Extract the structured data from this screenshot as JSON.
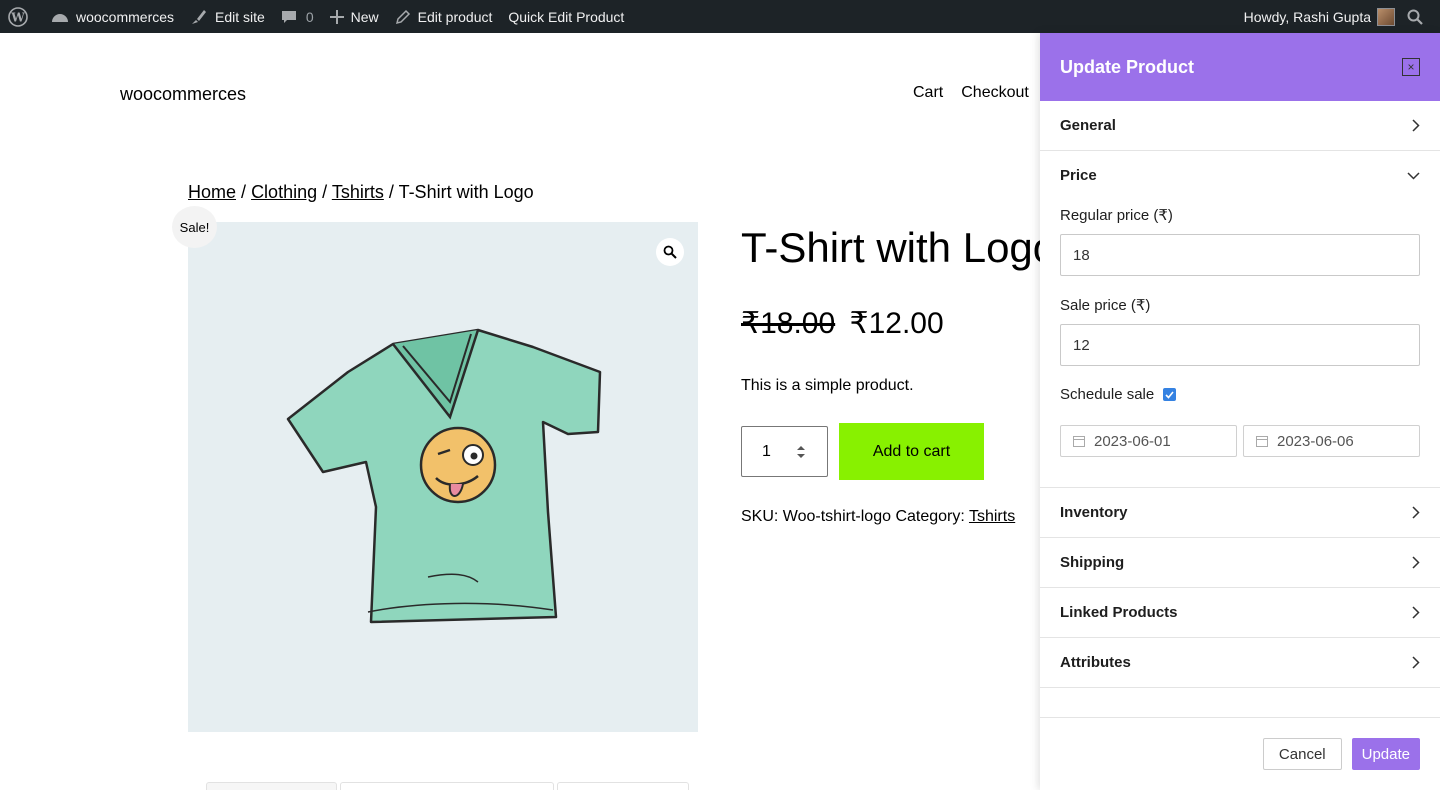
{
  "admin_bar": {
    "site_name": "woocommerces",
    "edit_site": "Edit site",
    "comments_count": "0",
    "new_label": "New",
    "edit_product": "Edit product",
    "quick_edit": "Quick Edit Product",
    "greeting": "Howdy, Rashi Gupta"
  },
  "site": {
    "title": "woocommerces",
    "nav": [
      "Cart",
      "Checkout"
    ]
  },
  "breadcrumb": {
    "home": "Home",
    "sep": "/",
    "clothing": "Clothing",
    "tshirts": "Tshirts",
    "current": "T-Shirt with Logo"
  },
  "product": {
    "sale_badge": "Sale!",
    "title": "T-Shirt with Logo",
    "regular_price": "₹18.00",
    "sale_price": "₹12.00",
    "description": "This is a simple product.",
    "quantity": "1",
    "add_to_cart": "Add to cart",
    "sku_label": "SKU:",
    "sku": "Woo-tshirt-logo",
    "category_label": "Category:",
    "category": "Tshirts"
  },
  "panel": {
    "title": "Update Product",
    "close": "×",
    "sections": {
      "general": "General",
      "price": "Price",
      "inventory": "Inventory",
      "shipping": "Shipping",
      "linked": "Linked Products",
      "attributes": "Attributes"
    },
    "price": {
      "regular_label": "Regular price (₹)",
      "regular_value": "18",
      "sale_label": "Sale price (₹)",
      "sale_value": "12",
      "schedule_label": "Schedule sale",
      "schedule_checked": true,
      "date_from": "2023-06-01",
      "date_to": "2023-06-06"
    },
    "cancel": "Cancel",
    "update": "Update"
  },
  "colors": {
    "accent": "#9b71ea",
    "add_to_cart": "#88f100",
    "admin_bar": "#1d2327"
  }
}
